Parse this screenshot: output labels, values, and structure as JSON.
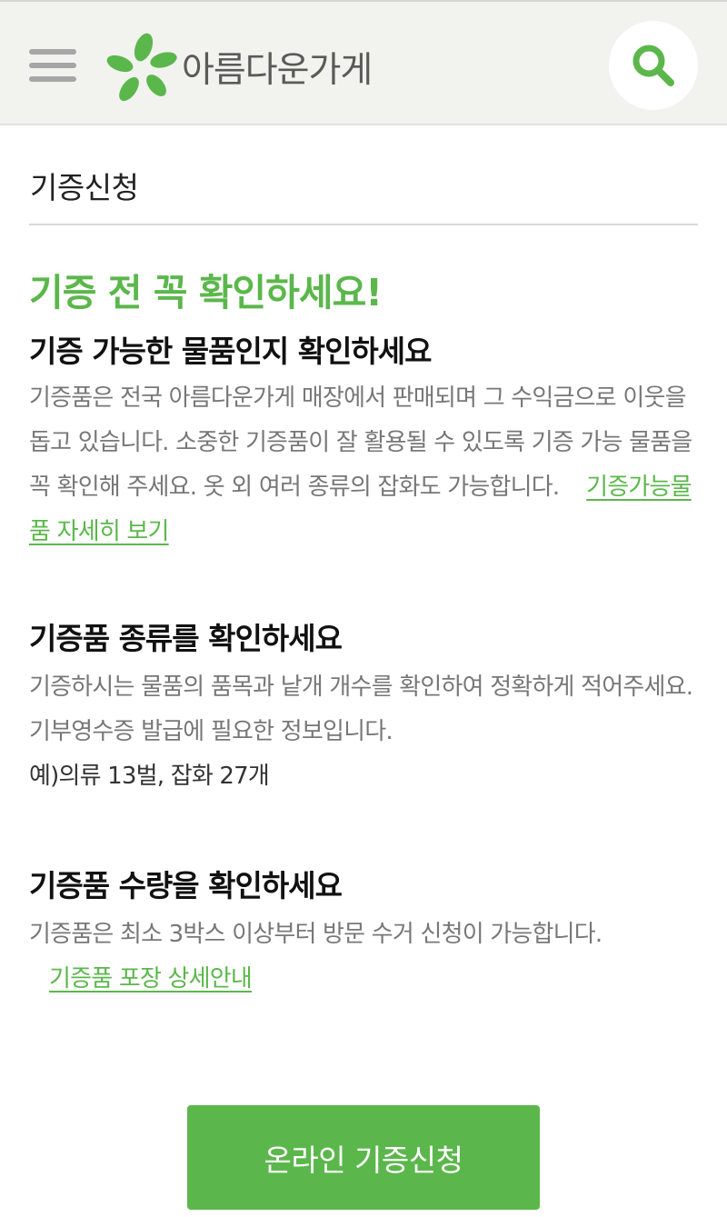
{
  "header": {
    "logo_text": "아름다운가게"
  },
  "page": {
    "title": "기증신청",
    "notice_heading": "기증 전 꼭 확인하세요!"
  },
  "sections": [
    {
      "title": "기증 가능한 물품인지 확인하세요",
      "body": "기증품은 전국 아름다운가게 매장에서 판매되며 그 수익금으로 이웃을 돕고 있습니다. 소중한 기증품이 잘 활용될 수 있도록 기증 가능 물품을 꼭 확인해 주세요. 옷 외 여러 종류의 잡화도 가능합니다.",
      "link": "기증가능물품 자세히 보기"
    },
    {
      "title": "기증품 종류를 확인하세요",
      "body": "기증하시는 물품의 품목과 낱개 개수를 확인하여 정확하게 적어주세요. 기부영수증 발급에 필요한 정보입니다.",
      "example": "예)의류 13벌, 잡화 27개"
    },
    {
      "title": "기증품 수량을 확인하세요",
      "body": "기증품은 최소 3박스 이상부터 방문 수거 신청이 가능합니다.",
      "link": "기증품 포장 상세안내"
    }
  ],
  "cta": {
    "label": "온라인 기증신청"
  },
  "colors": {
    "brand_green": "#5bb74b",
    "header_bg": "#f2f3ef",
    "body_text": "#777777"
  },
  "icons": {
    "menu": "hamburger-menu-icon",
    "logo": "leaf-logo-icon",
    "search": "search-icon"
  }
}
